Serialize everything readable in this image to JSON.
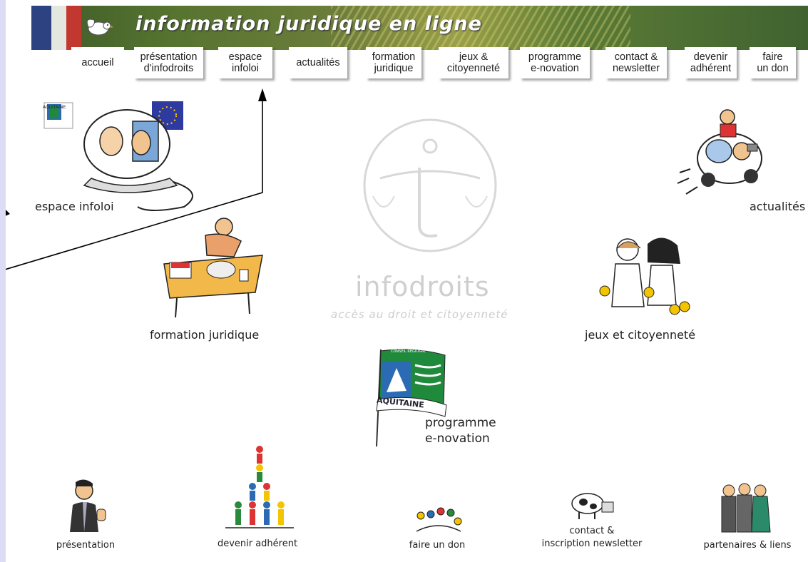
{
  "banner": {
    "title": "information juridique en ligne"
  },
  "nav": {
    "items": [
      {
        "label": "accueil"
      },
      {
        "label": "présentation\nd'infodroits"
      },
      {
        "label": "espace\ninfoloi"
      },
      {
        "label": "actualités"
      },
      {
        "label": "formation\njuridique"
      },
      {
        "label": "jeux &\ncitoyenneté"
      },
      {
        "label": "programme\ne-novation"
      },
      {
        "label": "contact &\nnewsletter"
      },
      {
        "label": "devenir\nadhérent"
      },
      {
        "label": "faire\nun don"
      }
    ]
  },
  "logo": {
    "word": "infodroits",
    "subtitle": "accès au droit et citoyenneté"
  },
  "sections": {
    "espace_infoloi": "espace infoloi",
    "actualites": "actualités",
    "formation": "formation juridique",
    "jeux": "jeux et citoyenneté",
    "programme_line1": "programme",
    "programme_line2": "e-novation"
  },
  "bottom": {
    "presentation": "présentation",
    "adherent": "devenir adhérent",
    "don": "faire un don",
    "contact_line1": "contact &",
    "contact_line2": "inscription newsletter",
    "partenaires": "partenaires & liens"
  },
  "badges": {
    "aquitaine_small": "AQUITAINE",
    "aquitaine_flag": "AQUITAINE",
    "region_ribbon": "CONSEIL RÉGIONAL"
  },
  "colors": {
    "aquitaine_green": "#1f8a3c",
    "aquitaine_blue": "#2a6bb3",
    "eu_blue": "#2f3aa0"
  }
}
